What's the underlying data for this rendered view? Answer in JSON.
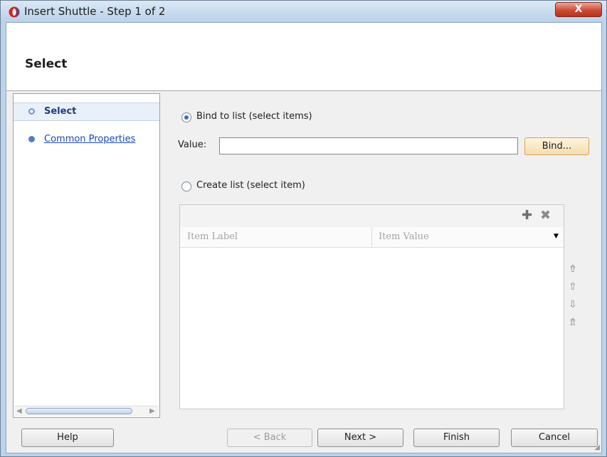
{
  "window": {
    "title": "Insert Shuttle - Step 1 of 2",
    "close_label": "X"
  },
  "header": {
    "title": "Select"
  },
  "nav": {
    "steps": [
      {
        "label": "Select",
        "active": true
      },
      {
        "label": "Common Properties",
        "active": false
      }
    ]
  },
  "content": {
    "bind_option": {
      "label": "Bind to list (select items)",
      "selected": true
    },
    "value_label": "Value:",
    "value": "",
    "bind_button": "Bind...",
    "create_option": {
      "label": "Create list (select item)",
      "selected": false
    },
    "table": {
      "columns": [
        "Item Label",
        "Item Value"
      ],
      "rows": []
    }
  },
  "footer": {
    "help": "Help",
    "back": "< Back",
    "next": "Next >",
    "finish": "Finish",
    "cancel": "Cancel"
  },
  "colors": {
    "accent": "#3d6ec4",
    "link": "#1848b7",
    "close": "#cb4b34"
  }
}
